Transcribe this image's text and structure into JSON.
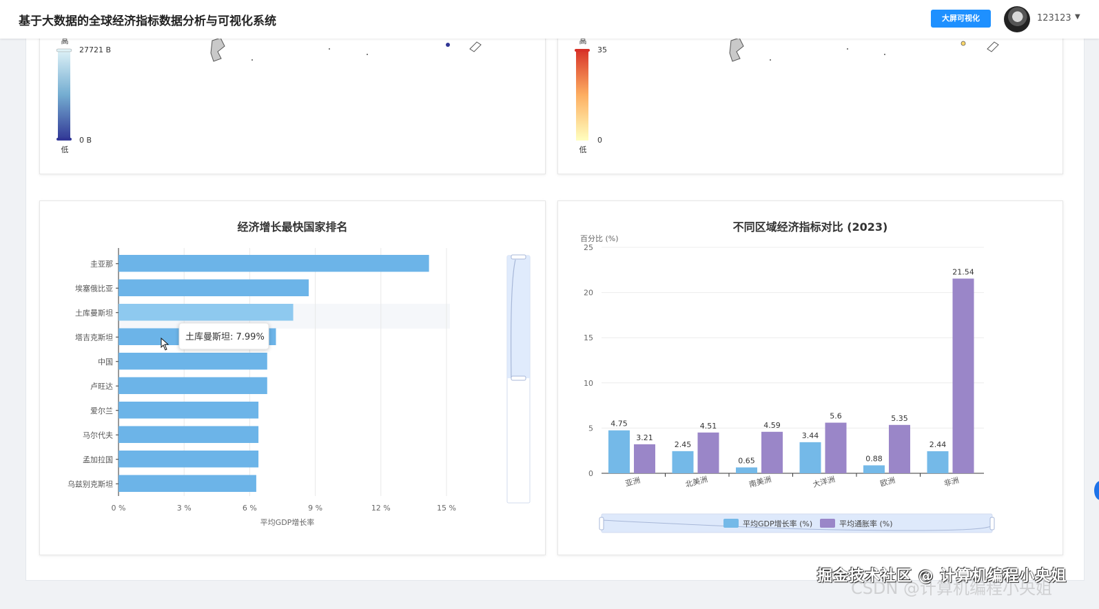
{
  "header": {
    "title": "基于大数据的全球经济指标数据分析与可视化系统",
    "big_screen_button": "大屏可视化",
    "username": "123123",
    "caret": "▼"
  },
  "top_left_map": {
    "legend_high": "高",
    "legend_low": "低",
    "max_label": "27721 B",
    "min_label": "0 B",
    "colors": [
      "#e0f3f8",
      "#74add1",
      "#313695"
    ]
  },
  "top_right_map": {
    "legend_high": "高",
    "legend_low": "低",
    "max_label": "35",
    "min_label": "0",
    "colors": [
      "#ffffbf",
      "#fdae61",
      "#d73027"
    ]
  },
  "growth_chart": {
    "title": "经济增长最快国家排名",
    "xlabel": "平均GDP增长率",
    "tooltip": "土库曼斯坦: 7.99%",
    "bar_color": "#6cb4e8",
    "highlight_color": "#8ec9ef"
  },
  "region_chart": {
    "title": "不同区域经济指标对比 (2023)",
    "ylabel": "百分比 (%)",
    "series1_color": "#74b9e8",
    "series2_color": "#9a86c8"
  },
  "chart_data": [
    {
      "type": "bar",
      "orientation": "horizontal",
      "title": "经济增长最快国家排名",
      "xlabel": "平均GDP增长率",
      "categories": [
        "圭亚那",
        "埃塞俄比亚",
        "土库曼斯坦",
        "塔吉克斯坦",
        "中国",
        "卢旺达",
        "爱尔兰",
        "马尔代夫",
        "孟加拉国",
        "乌兹别克斯坦"
      ],
      "values": [
        14.2,
        8.7,
        7.99,
        7.2,
        6.8,
        6.8,
        6.4,
        6.4,
        6.4,
        6.3
      ],
      "xticks": [
        "0 %",
        "3 %",
        "6 %",
        "9 %",
        "12 %",
        "15 %"
      ],
      "xlim": [
        0,
        15
      ],
      "grid": true
    },
    {
      "type": "bar",
      "title": "不同区域经济指标对比 (2023)",
      "ylabel": "百分比 (%)",
      "categories": [
        "亚洲",
        "北美洲",
        "南美洲",
        "大洋洲",
        "欧洲",
        "非洲"
      ],
      "series": [
        {
          "name": "平均GDP增长率 (%)",
          "values": [
            4.75,
            2.45,
            0.65,
            3.44,
            0.88,
            2.44
          ]
        },
        {
          "name": "平均通胀率 (%)",
          "values": [
            3.21,
            4.51,
            4.59,
            5.6,
            5.35,
            21.54
          ]
        }
      ],
      "yticks": [
        "0",
        "5",
        "10",
        "15",
        "20",
        "25"
      ],
      "ylim": [
        0,
        25
      ],
      "legend": "bottom",
      "grid": true
    }
  ],
  "watermark": {
    "line1": "掘金技术社区 @ 计算机编程小央姐",
    "line2": "CSDN @计算机编程小央姐"
  }
}
